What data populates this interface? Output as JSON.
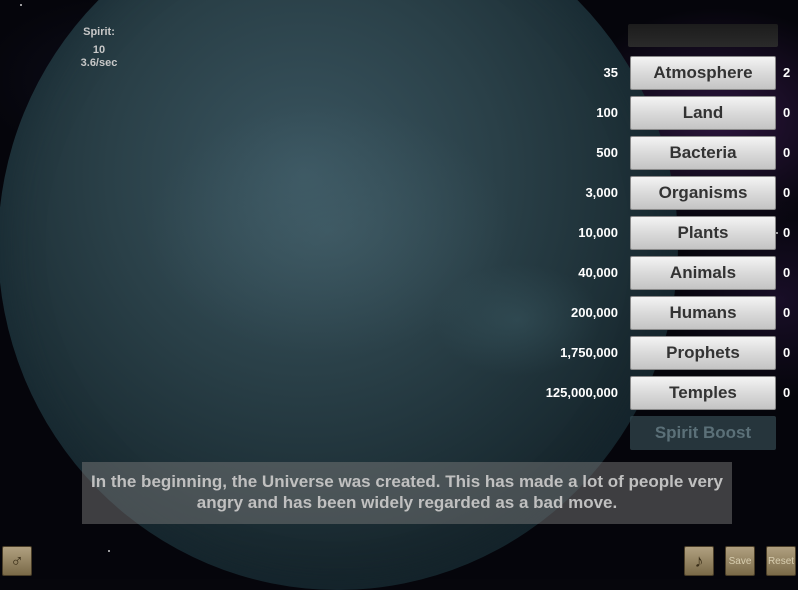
{
  "spirit": {
    "label": "Spirit:",
    "amount": "10",
    "rate": "3.6/sec"
  },
  "upgrades": [
    {
      "cost": "35",
      "label": "Atmosphere",
      "count": "2"
    },
    {
      "cost": "100",
      "label": "Land",
      "count": "0"
    },
    {
      "cost": "500",
      "label": "Bacteria",
      "count": "0"
    },
    {
      "cost": "3,000",
      "label": "Organisms",
      "count": "0"
    },
    {
      "cost": "10,000",
      "label": "Plants",
      "count": "0"
    },
    {
      "cost": "40,000",
      "label": "Animals",
      "count": "0"
    },
    {
      "cost": "200,000",
      "label": "Humans",
      "count": "0"
    },
    {
      "cost": "1,750,000",
      "label": "Prophets",
      "count": "0"
    },
    {
      "cost": "125,000,000",
      "label": "Temples",
      "count": "0"
    }
  ],
  "boost": {
    "label": "Spirit Boost",
    "enabled": false
  },
  "message": "In the beginning, the Universe was created. This has made a lot of people very angry and has been widely regarded as a bad move.",
  "toolbar": {
    "left_icon": "god-symbol-icon",
    "music_icon": "music-note-icon",
    "save_label": "Save",
    "reset_label": "Reset"
  }
}
